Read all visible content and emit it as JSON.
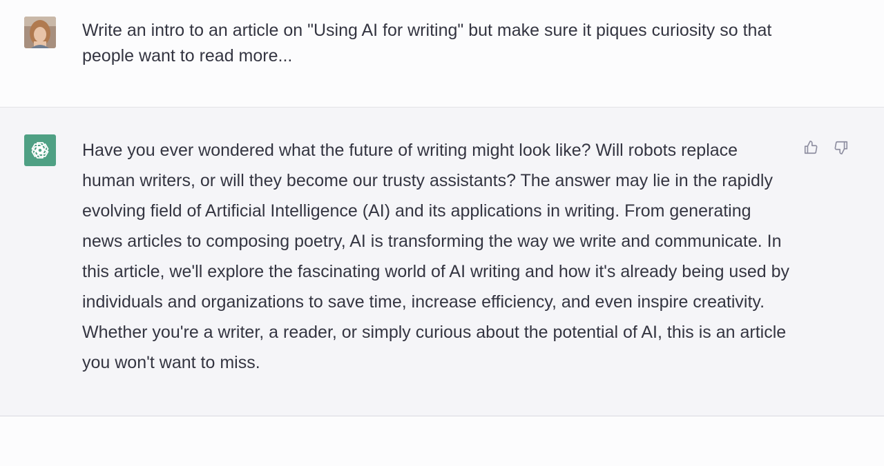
{
  "conversation": {
    "user_message": {
      "text": "Write an intro to an article on \"Using AI for writing\" but make sure it piques curiosity so that people want to read more..."
    },
    "assistant_message": {
      "text": "Have you ever wondered what the future of writing might look like? Will robots replace human writers, or will they become our trusty assistants? The answer may lie in the rapidly evolving field of Artificial Intelligence (AI) and its applications in writing. From generating news articles to composing poetry, AI is transforming the way we write and communicate. In this article, we'll explore the fascinating world of AI writing and how it's already being used by individuals and organizations to save time, increase efficiency, and even inspire creativity. Whether you're a writer, a reader, or simply curious about the potential of AI, this is an article you won't want to miss."
    }
  },
  "icons": {
    "user_avatar": "user-avatar",
    "assistant_avatar": "openai-logo-icon",
    "thumb_up": "thumbs-up-icon",
    "thumb_down": "thumbs-down-icon"
  },
  "colors": {
    "user_bg": "#fcfcfd",
    "assistant_bg": "#f5f5f8",
    "assistant_avatar_bg": "#4fa084",
    "text": "#343541",
    "icon": "#8e8ea0"
  }
}
